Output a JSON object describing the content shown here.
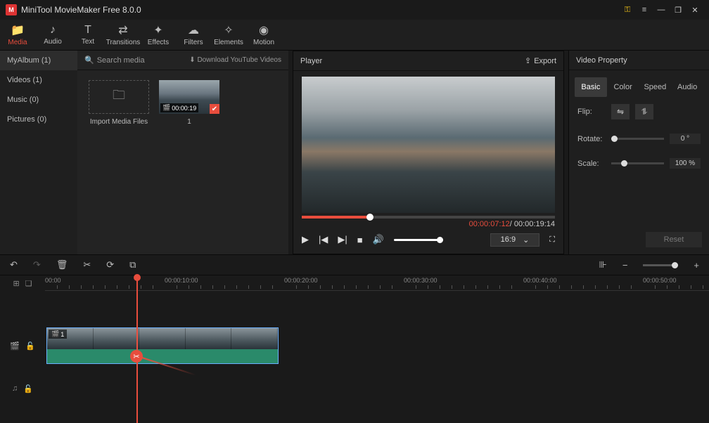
{
  "title": "MiniTool MovieMaker Free 8.0.0",
  "toolbar": [
    {
      "icon": "📁",
      "label": "Media",
      "active": true
    },
    {
      "icon": "♪",
      "label": "Audio"
    },
    {
      "icon": "T",
      "label": "Text"
    },
    {
      "icon": "⇄",
      "label": "Transitions"
    },
    {
      "icon": "✦",
      "label": "Effects"
    },
    {
      "icon": "☁",
      "label": "Filters"
    },
    {
      "icon": "✧",
      "label": "Elements"
    },
    {
      "icon": "◉",
      "label": "Motion"
    }
  ],
  "sidebar": [
    {
      "label": "MyAlbum (1)",
      "active": true
    },
    {
      "label": "Videos (1)"
    },
    {
      "label": "Music (0)"
    },
    {
      "label": "Pictures (0)"
    }
  ],
  "search_placeholder": "Search media",
  "download_label": "Download YouTube Videos",
  "import_label": "Import Media Files",
  "clip_duration": "00:00:19",
  "clip_count": "1",
  "player_label": "Player",
  "export_label": "Export",
  "time_current": "00:00:07:12",
  "time_total": " / 00:00:19:14",
  "aspect_ratio": "16:9",
  "props_title": "Video Property",
  "prop_tabs": [
    "Basic",
    "Color",
    "Speed",
    "Audio"
  ],
  "flip_label": "Flip:",
  "rotate_label": "Rotate:",
  "rotate_value": "0 °",
  "scale_label": "Scale:",
  "scale_value": "100 %",
  "reset_label": "Reset",
  "ruler": [
    "00:00",
    "00:00:10:00",
    "00:00:20:00",
    "00:00:30:00",
    "00:00:40:00",
    "00:00:50:00"
  ],
  "clip_badge": "1"
}
